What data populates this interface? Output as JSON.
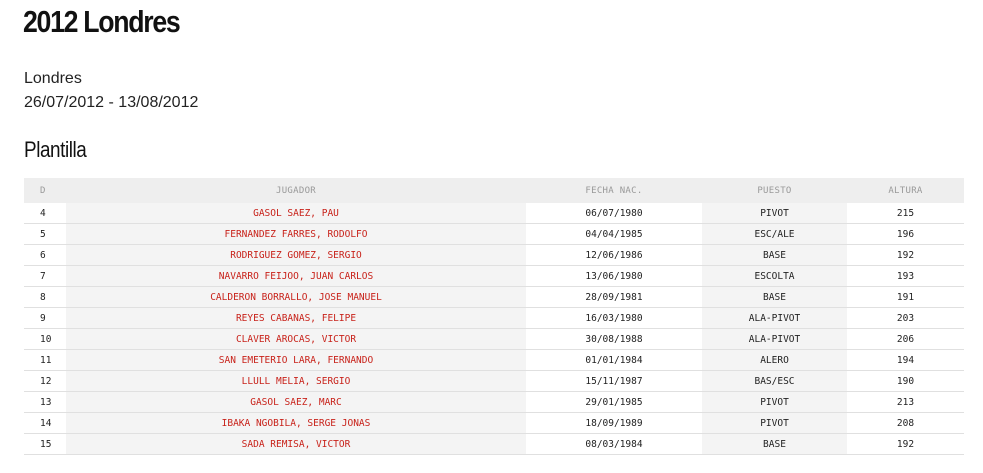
{
  "page": {
    "title": "2012 Londres",
    "city": "Londres",
    "dates": "26/07/2012 - 13/08/2012",
    "section_title": "Plantilla"
  },
  "table": {
    "headers": [
      "D",
      "JUGADOR",
      "FECHA NAC.",
      "PUESTO",
      "ALTURA"
    ],
    "rows": [
      {
        "dorsal": "4",
        "jugador": "GASOL SAEZ, PAU",
        "fecha": "06/07/1980",
        "puesto": "PIVOT",
        "altura": "215"
      },
      {
        "dorsal": "5",
        "jugador": "FERNANDEZ FARRES, RODOLFO",
        "fecha": "04/04/1985",
        "puesto": "ESC/ALE",
        "altura": "196"
      },
      {
        "dorsal": "6",
        "jugador": "RODRIGUEZ GOMEZ, SERGIO",
        "fecha": "12/06/1986",
        "puesto": "BASE",
        "altura": "192"
      },
      {
        "dorsal": "7",
        "jugador": "NAVARRO FEIJOO, JUAN CARLOS",
        "fecha": "13/06/1980",
        "puesto": "ESCOLTA",
        "altura": "193"
      },
      {
        "dorsal": "8",
        "jugador": "CALDERON BORRALLO, JOSE MANUEL",
        "fecha": "28/09/1981",
        "puesto": "BASE",
        "altura": "191"
      },
      {
        "dorsal": "9",
        "jugador": "REYES CABANAS, FELIPE",
        "fecha": "16/03/1980",
        "puesto": "ALA-PIVOT",
        "altura": "203"
      },
      {
        "dorsal": "10",
        "jugador": "CLAVER AROCAS, VICTOR",
        "fecha": "30/08/1988",
        "puesto": "ALA-PIVOT",
        "altura": "206"
      },
      {
        "dorsal": "11",
        "jugador": "SAN EMETERIO LARA, FERNANDO",
        "fecha": "01/01/1984",
        "puesto": "ALERO",
        "altura": "194"
      },
      {
        "dorsal": "12",
        "jugador": "LLULL MELIA, SERGIO",
        "fecha": "15/11/1987",
        "puesto": "BAS/ESC",
        "altura": "190"
      },
      {
        "dorsal": "13",
        "jugador": "GASOL SAEZ, MARC",
        "fecha": "29/01/1985",
        "puesto": "PIVOT",
        "altura": "213"
      },
      {
        "dorsal": "14",
        "jugador": "IBAKA NGOBILA, SERGE JONAS",
        "fecha": "18/09/1989",
        "puesto": "PIVOT",
        "altura": "208"
      },
      {
        "dorsal": "15",
        "jugador": "SADA REMISA, VICTOR",
        "fecha": "08/03/1984",
        "puesto": "BASE",
        "altura": "192"
      }
    ]
  },
  "colors": {
    "player_link": "#c8221a",
    "header_bg": "#eeeeee",
    "stripe_bg": "#f4f4f4"
  }
}
